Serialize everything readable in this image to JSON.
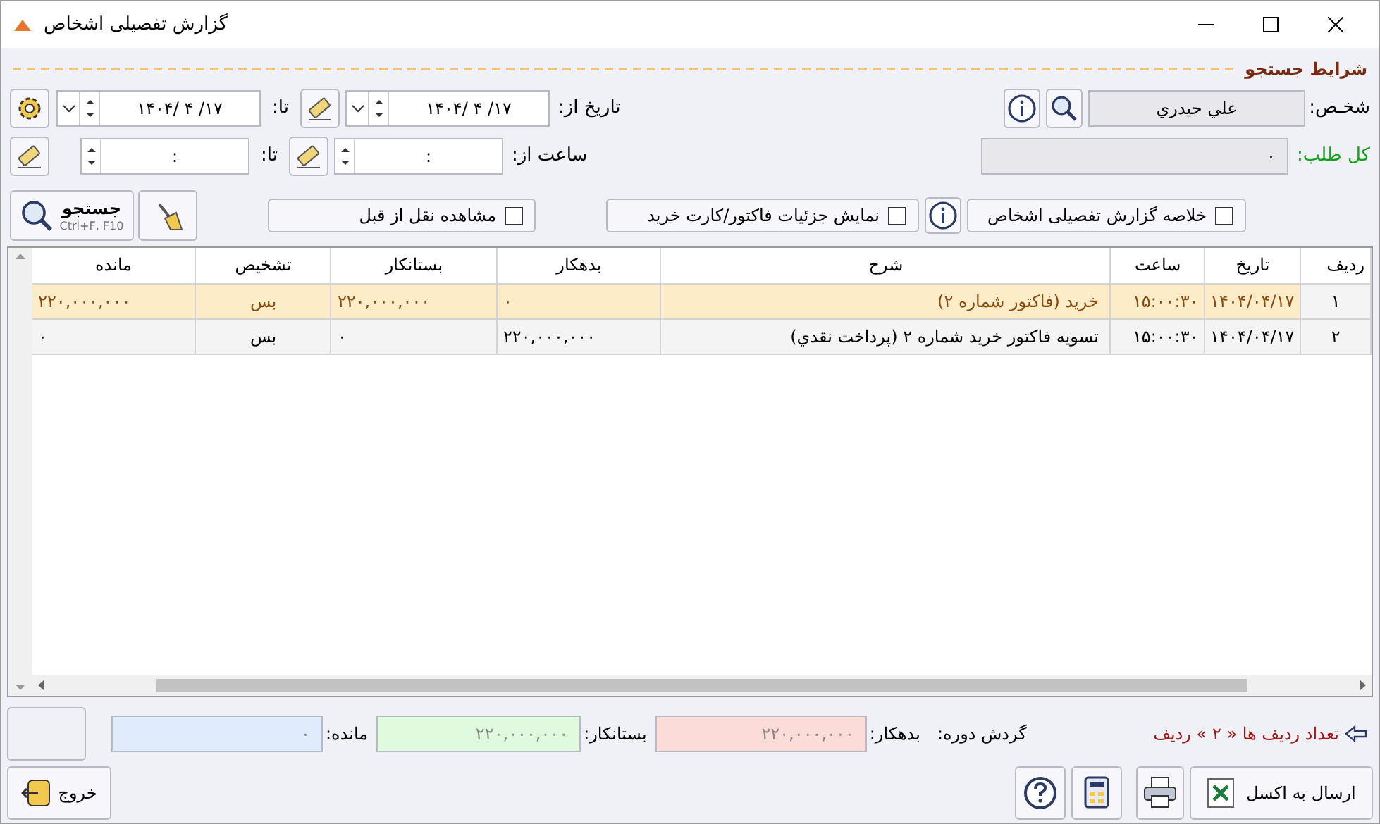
{
  "window": {
    "title": "گزارش تفصیلی اشخاص"
  },
  "section_title": "شرايط جستجو",
  "person": {
    "label": "شخـص:",
    "value": "علي حيدري"
  },
  "total_credit": {
    "label": "کل طلب:",
    "value": "۰"
  },
  "date_from": {
    "label": "تاريخ از:",
    "value": "۱۴۰۴/ ۴ /۱۷"
  },
  "date_to": {
    "label": "تا:",
    "value": "۱۴۰۴/ ۴ /۱۷"
  },
  "time_from": {
    "label": "ساعت از:",
    "value": ":"
  },
  "time_to": {
    "label": "تا:",
    "value": ":"
  },
  "search_button": {
    "label": "جستجو",
    "shortcut": "Ctrl+F, F10"
  },
  "options": [
    {
      "label": "خلاصه گزارش تفصیلی اشخاص",
      "checked": false
    },
    {
      "label": "نمایش جزئیات فاکتور/کارت خرید",
      "checked": false
    },
    {
      "label": "مشاهده نقل از قبل",
      "checked": false
    }
  ],
  "table": {
    "columns": [
      "ردیف",
      "تاریخ",
      "ساعت",
      "شرح",
      "بدهکار",
      "بستانکار",
      "تشخیص",
      "مانده"
    ],
    "rows": [
      {
        "selected": true,
        "cells": [
          "۱",
          "۱۴۰۴/۰۴/۱۷",
          "۱۵:۰۰:۳۰",
          "خرید (فاکتور شماره ۲)",
          "۰",
          "۲۲۰,۰۰۰,۰۰۰",
          "بس",
          "۲۲۰,۰۰۰,۰۰۰"
        ]
      },
      {
        "selected": false,
        "cells": [
          "۲",
          "۱۴۰۴/۰۴/۱۷",
          "۱۵:۰۰:۳۰",
          "تسویه فاکتور خرید شماره ۲ (پرداخت نقدي)",
          "۲۲۰,۰۰۰,۰۰۰",
          "۰",
          "بس",
          "۰"
        ]
      }
    ]
  },
  "row_count": "تعداد ردیف ها « ۲ » ردیف",
  "period_label": "گردش دوره:",
  "totals": [
    {
      "kind": "debit",
      "label": "بدهکار:",
      "value": "۲۲۰,۰۰۰,۰۰۰"
    },
    {
      "kind": "credit",
      "label": "بستانکار:",
      "value": "۲۲۰,۰۰۰,۰۰۰"
    },
    {
      "kind": "balance",
      "label": "مانده:",
      "value": "۰"
    }
  ],
  "buttons": {
    "exit": "خروج",
    "excel": "ارسال به اکسل"
  }
}
